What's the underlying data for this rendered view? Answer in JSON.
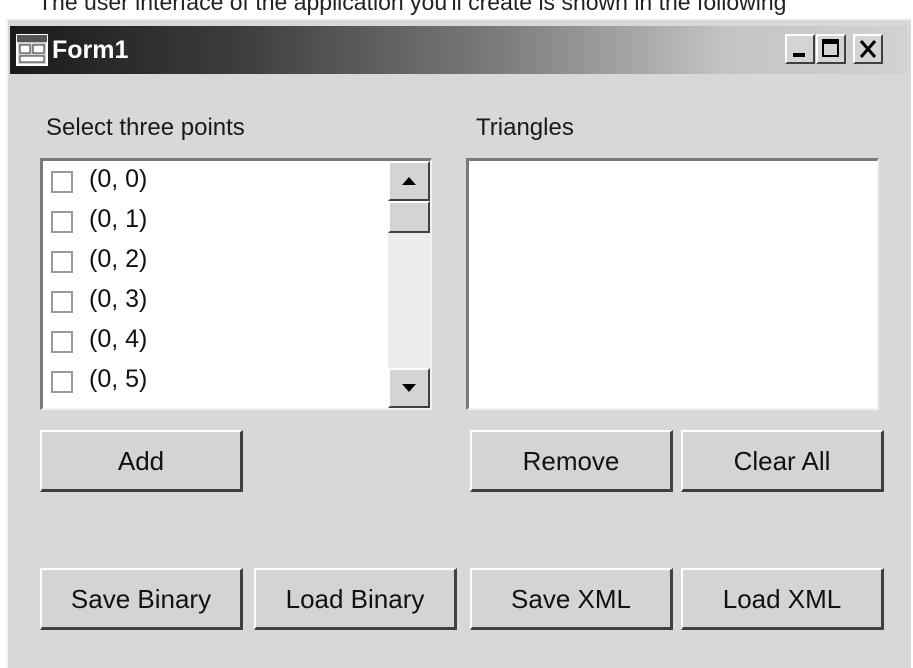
{
  "caption_text": "The user interface of the application you'll create is shown in the following",
  "window": {
    "title": "Form1",
    "controls": [
      "minimize-icon",
      "maximize-icon",
      "close-icon"
    ]
  },
  "labels": {
    "points": "Select three points",
    "triangles": "Triangles"
  },
  "points_list": {
    "items": [
      "(0, 0)",
      "(0, 1)",
      "(0, 2)",
      "(0, 3)",
      "(0, 4)",
      "(0, 5)"
    ]
  },
  "triangles_list": {
    "items": []
  },
  "buttons": {
    "add": "Add",
    "remove": "Remove",
    "clear_all": "Clear All",
    "save_binary": "Save Binary",
    "load_binary": "Load Binary",
    "save_xml": "Save XML",
    "load_xml": "Load XML"
  }
}
